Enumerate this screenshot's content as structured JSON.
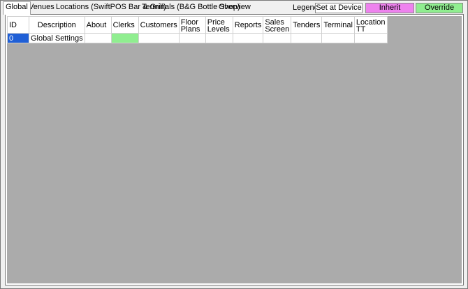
{
  "tabs": [
    "Global",
    "Venues",
    "Locations (SwiftPOS Bar & Grill)",
    "Terminals (B&G Bottle Shop)",
    "Overview"
  ],
  "legend": {
    "label": "Legend",
    "set_at_device": "Set at Device",
    "inherit": "Inherit",
    "override": "Override",
    "colors": {
      "set_at_device": "#ffffff",
      "inherit": "#ee82ee",
      "override": "#90ee90"
    }
  },
  "grid": {
    "columns": [
      {
        "l1": "ID",
        "l2": ""
      },
      {
        "l1": "Description",
        "l2": ""
      },
      {
        "l1": "About",
        "l2": ""
      },
      {
        "l1": "Clerks",
        "l2": ""
      },
      {
        "l1": "Customers",
        "l2": ""
      },
      {
        "l1": "Floor",
        "l2": "Plans"
      },
      {
        "l1": "Price",
        "l2": "Levels"
      },
      {
        "l1": "Reports",
        "l2": ""
      },
      {
        "l1": "Sales",
        "l2": "Screen"
      },
      {
        "l1": "Tenders",
        "l2": ""
      },
      {
        "l1": "Terminal",
        "l2": ""
      },
      {
        "l1": "Location",
        "l2": "TT"
      }
    ],
    "rows": [
      {
        "cells": [
          "0",
          "Global Settings",
          "",
          "",
          "",
          "",
          "",
          "",
          "",
          "",
          "",
          ""
        ],
        "states": [
          "selected",
          "",
          "",
          "override",
          "",
          "",
          "",
          "",
          "",
          "",
          "",
          ""
        ]
      }
    ]
  }
}
